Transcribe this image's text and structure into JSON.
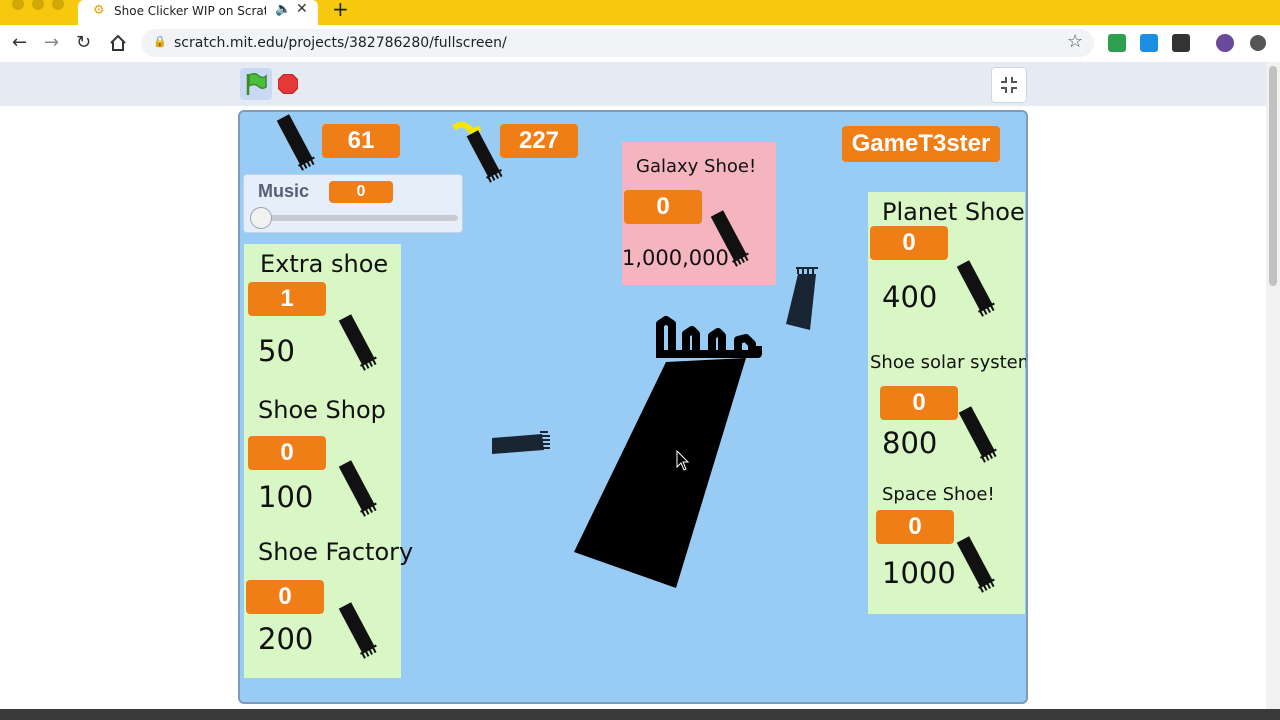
{
  "browser": {
    "tab_title": "Shoe Clicker WIP on Scratch",
    "new_tab_label": "+",
    "url": "scratch.mit.edu/projects/382786280/fullscreen/"
  },
  "icons": {
    "back": "back-arrow-icon",
    "forward": "forward-arrow-icon",
    "reload": "reload-icon",
    "home": "home-icon",
    "lock": "lock-icon",
    "bookmark": "star-icon",
    "green_flag": "green-flag-icon",
    "stop": "stop-sign-icon",
    "exit_fullscreen": "exit-fullscreen-icon",
    "shoe": "shoe-icon"
  },
  "colors": {
    "accent_yellow": "#f6c90e",
    "stage_blue": "#99ccf5",
    "badge_orange": "#f07e17",
    "panel_green": "#d8f7c5",
    "panel_pink": "#f4b5bf"
  },
  "game": {
    "counters": [
      {
        "value": "61"
      },
      {
        "value": "227"
      }
    ],
    "music": {
      "label": "Music",
      "value": "0"
    },
    "player_name": "GameT3ster",
    "galaxy": {
      "title": "Galaxy Shoe!",
      "count": "0",
      "price": "1,000,000"
    },
    "left_shop": [
      {
        "name": "Extra shoe",
        "count": "1",
        "price": "50"
      },
      {
        "name": "Shoe Shop",
        "count": "0",
        "price": "100"
      },
      {
        "name": "Shoe Factory",
        "count": "0",
        "price": "200"
      }
    ],
    "right_shop": [
      {
        "name": "Planet Shoe",
        "count": "0",
        "price": "400"
      },
      {
        "name": "Shoe solar system",
        "count": "0",
        "price": "800"
      },
      {
        "name": "Space Shoe!",
        "count": "0",
        "price": "1000"
      }
    ]
  }
}
